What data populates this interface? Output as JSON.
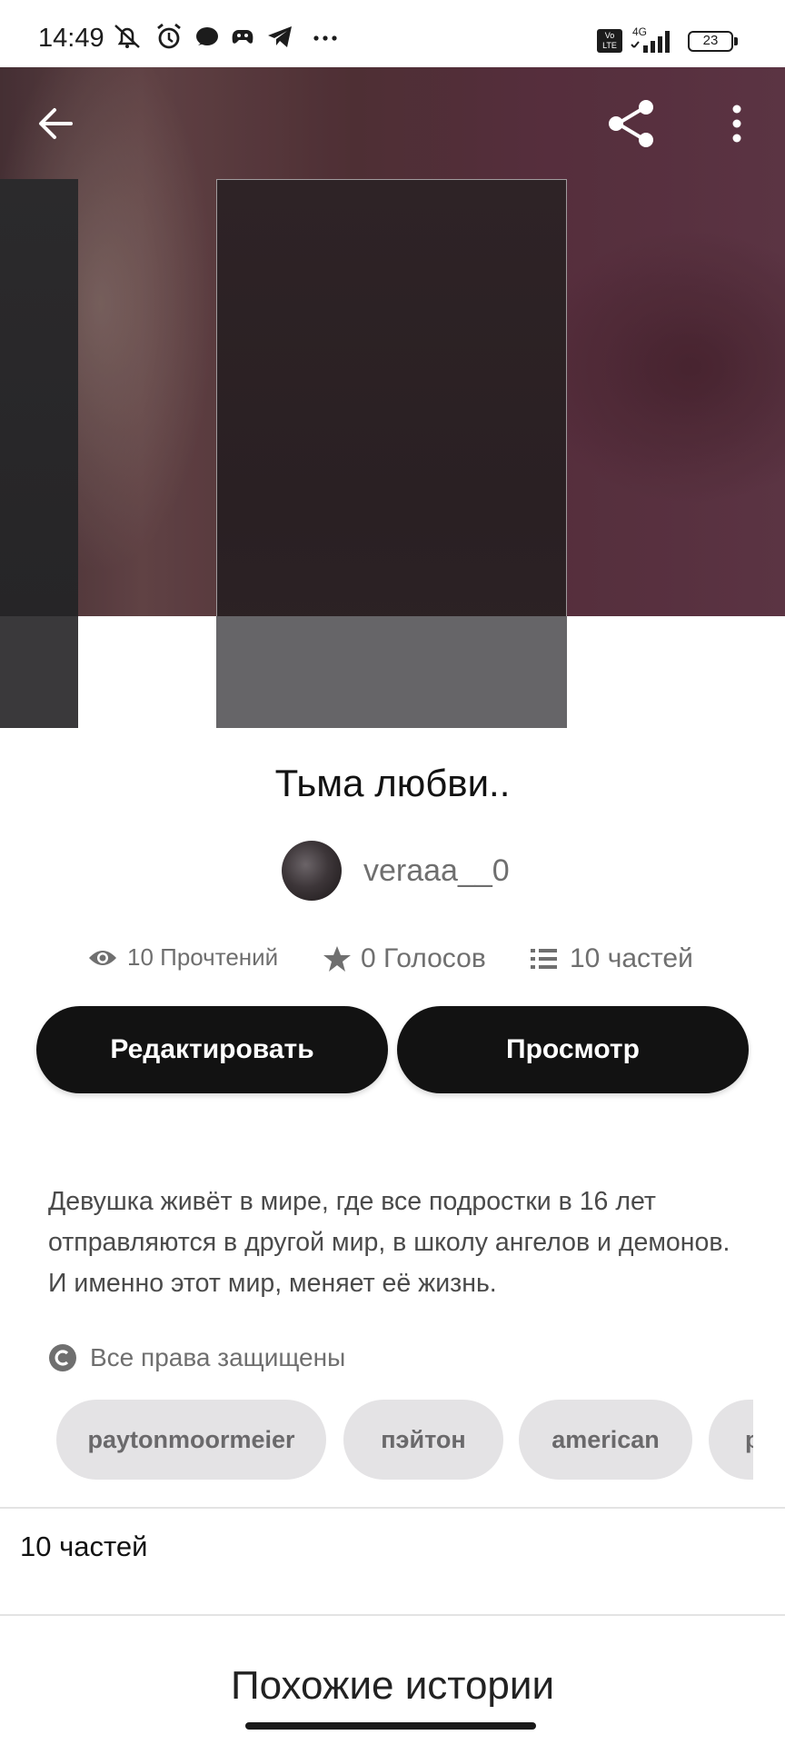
{
  "status_bar": {
    "time": "14:49",
    "network_type": "4G",
    "volte": "Vo LTE",
    "battery": "23"
  },
  "header": {
    "back_icon": "arrow-left-icon",
    "share_icon": "share-icon",
    "more_icon": "more-vert-icon"
  },
  "story": {
    "title": "Тьма любви..",
    "author": "veraaa__0",
    "stats": {
      "reads": "10 Прочтений",
      "votes": "0 Голосов",
      "parts": "10 частей"
    },
    "edit_button": "Редактировать",
    "preview_button": "Просмотр",
    "description": "Девушка живёт в мире, где все подростки в 16 лет отправляются в другой мир, в школу ангелов и демонов. И именно этот мир, меняет её жизнь.",
    "copyright": "Все права защищены",
    "tags": [
      "paytonmoormeier",
      "пэйтон",
      "american",
      "p"
    ]
  },
  "parts_section": {
    "label": "10 частей"
  },
  "similar_section": {
    "title": "Похожие истории"
  },
  "colors": {
    "button_bg": "#121212",
    "tag_bg": "#e4e3e5",
    "hero_tint": "#5e3343"
  }
}
